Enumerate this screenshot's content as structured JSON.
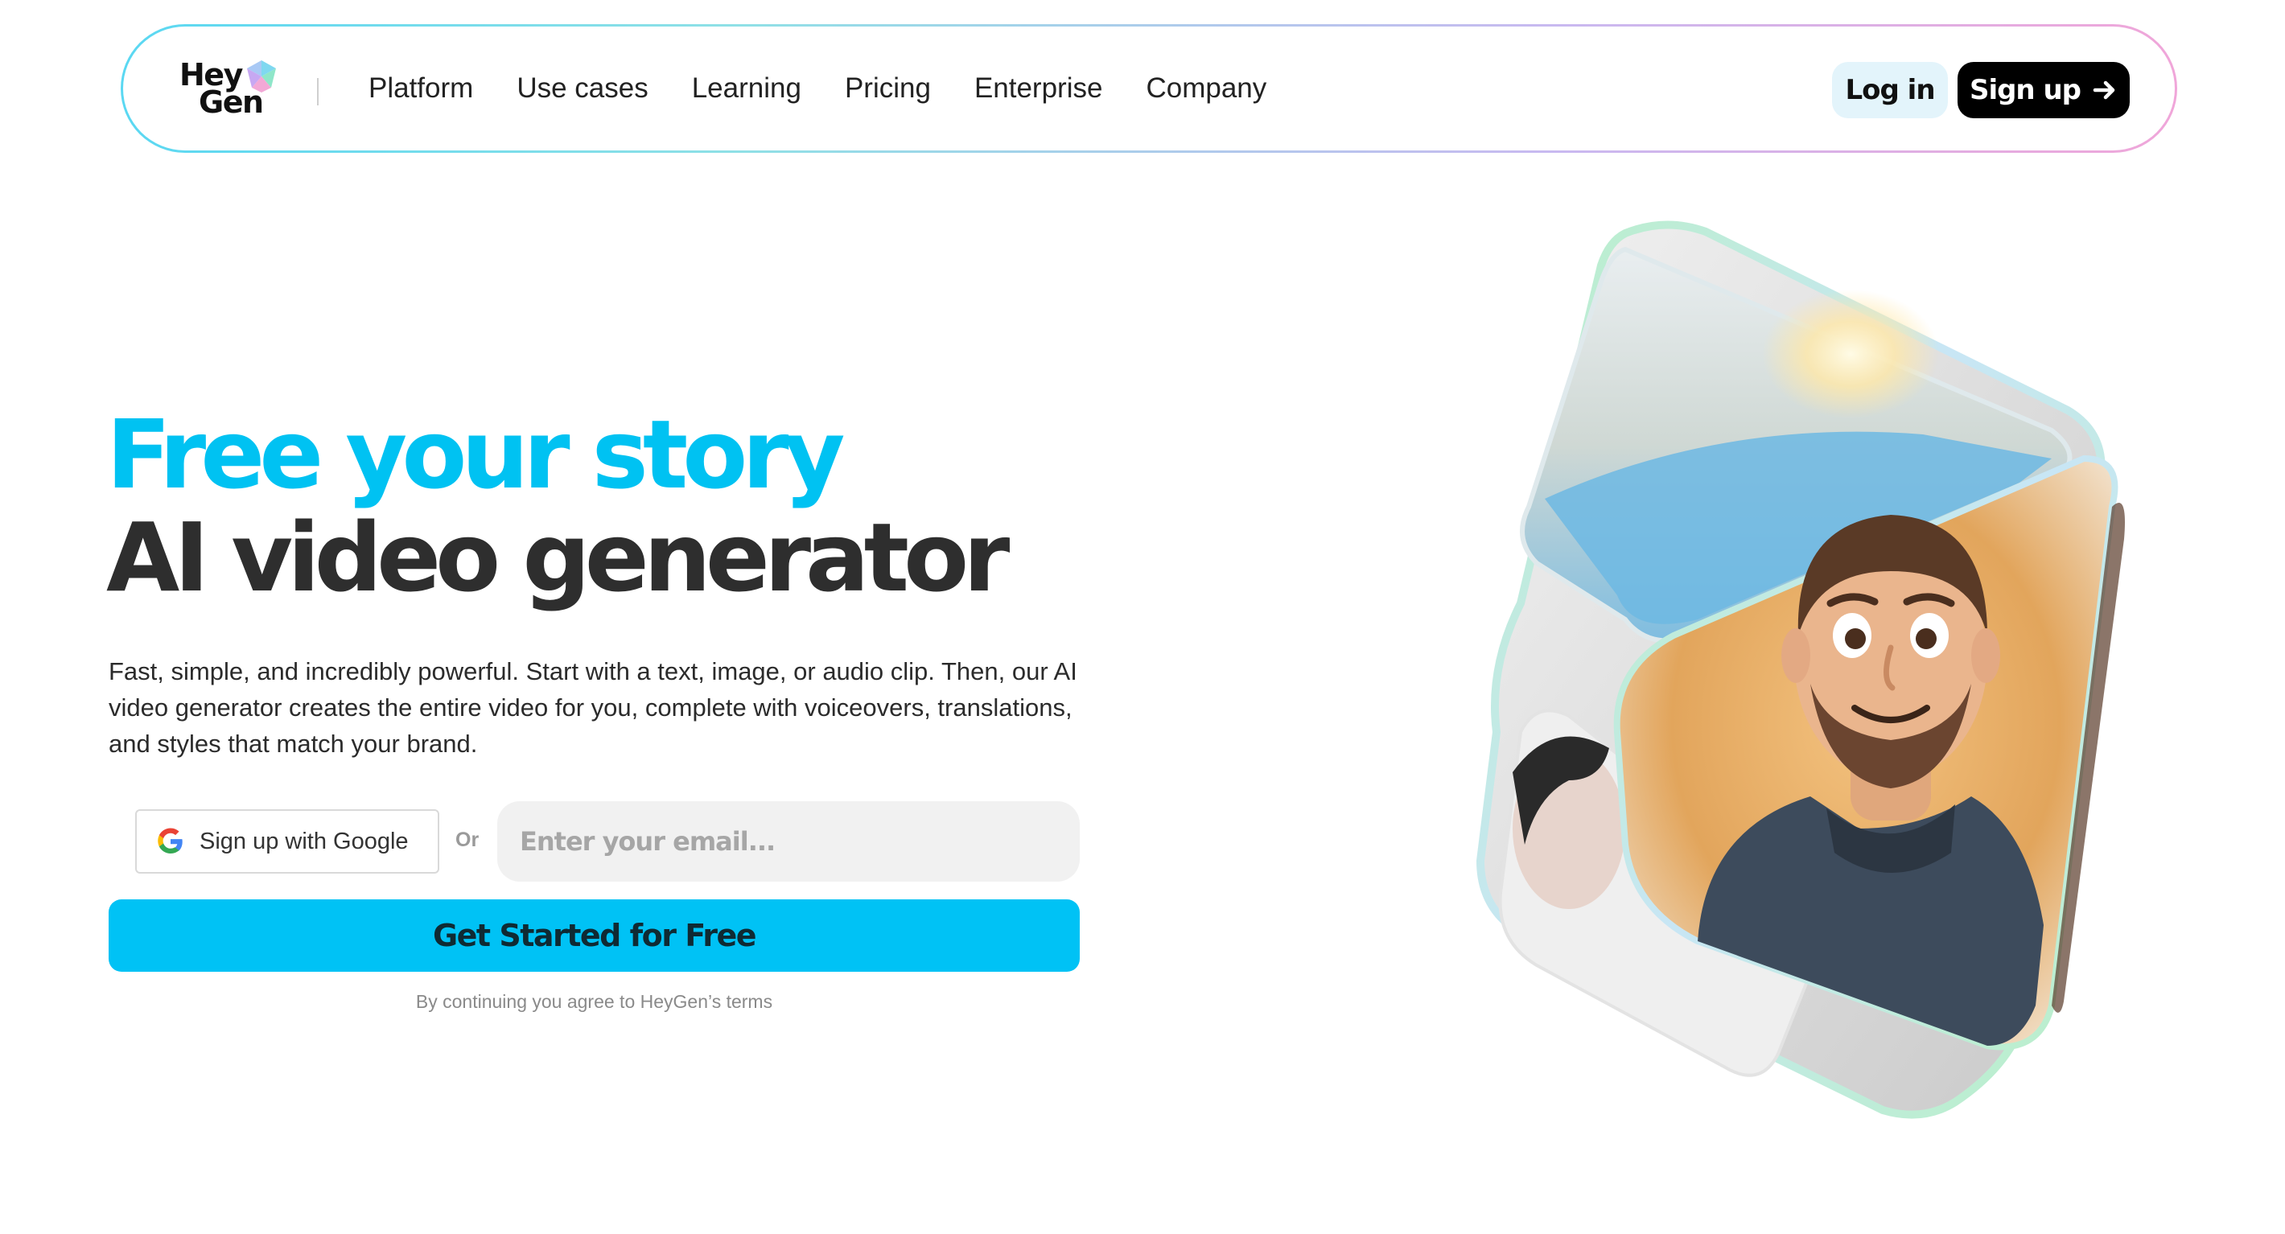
{
  "nav": {
    "logo_line1": "Hey",
    "logo_line2": "Gen",
    "links": [
      "Platform",
      "Use cases",
      "Learning",
      "Pricing",
      "Enterprise",
      "Company"
    ],
    "login_label": "Log in",
    "signup_label": "Sign up"
  },
  "hero": {
    "headline_line1": "Free your story",
    "headline_line2": "AI video generator",
    "description": "Fast, simple, and incredibly powerful. Start with a text, image, or audio clip. Then, our AI video generator creates the entire video for you, complete with voiceovers, translations, and styles that match your brand.",
    "google_signup_label": "Sign up with Google",
    "or_label": "Or",
    "email_placeholder": "Enter your email...",
    "cta_label": "Get Started for Free",
    "terms_text": "By continuing you agree to HeyGen’s terms"
  },
  "colors": {
    "accent": "#00c2f5",
    "headline_accent": "#00c2f2",
    "headline_dark": "#2e2e2e",
    "signup_bg": "#000000",
    "login_bg": "#e3f4fb"
  },
  "icons": {
    "logo": "heygen-gem-icon",
    "signup_arrow": "arrow-right-icon",
    "google": "google-icon"
  }
}
